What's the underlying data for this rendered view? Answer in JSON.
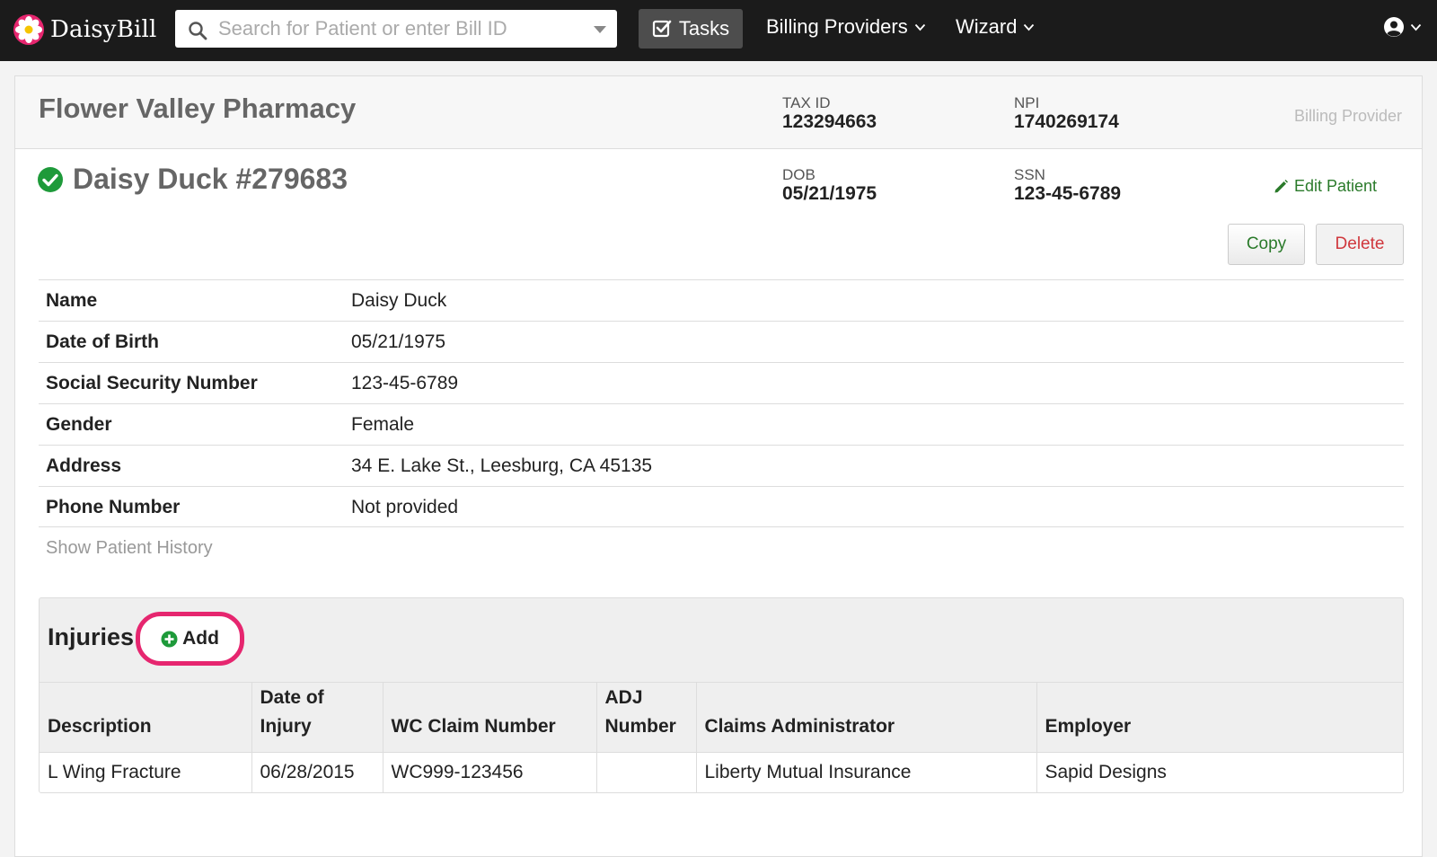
{
  "navbar": {
    "brand": "DaisyBill",
    "search_placeholder": "Search for Patient or enter Bill ID",
    "tasks_label": "Tasks",
    "billing_providers_label": "Billing Providers",
    "wizard_label": "Wizard"
  },
  "provider": {
    "name": "Flower Valley Pharmacy",
    "tax_id_label": "TAX ID",
    "tax_id": "123294663",
    "npi_label": "NPI",
    "npi": "1740269174",
    "role": "Billing Provider"
  },
  "patient": {
    "title": "Daisy Duck #279683",
    "dob_label": "DOB",
    "dob": "05/21/1975",
    "ssn_label": "SSN",
    "ssn": "123-45-6789",
    "edit_label": "Edit Patient",
    "copy_label": "Copy",
    "delete_label": "Delete"
  },
  "details": [
    {
      "label": "Name",
      "value": "Daisy Duck"
    },
    {
      "label": "Date of Birth",
      "value": "05/21/1975"
    },
    {
      "label": "Social Security Number",
      "value": "123-45-6789"
    },
    {
      "label": "Gender",
      "value": "Female"
    },
    {
      "label": "Address",
      "value": "34 E. Lake St., Leesburg, CA 45135"
    },
    {
      "label": "Phone Number",
      "value": "Not provided"
    }
  ],
  "show_history_label": "Show Patient History",
  "injuries": {
    "title": "Injuries",
    "add_label": "Add",
    "columns": [
      "Description",
      "Date of Injury",
      "WC Claim Number",
      "ADJ Number",
      "Claims Administrator",
      "Employer"
    ],
    "rows": [
      [
        "L Wing Fracture",
        "06/28/2015",
        "WC999-123456",
        "",
        "Liberty Mutual Insurance",
        "Sapid Designs"
      ]
    ]
  },
  "colors": {
    "navbar_bg": "#1b1b1b",
    "success_green": "#1e9a3a",
    "delete_red": "#d0383d",
    "highlight_pink": "#e6266f"
  }
}
